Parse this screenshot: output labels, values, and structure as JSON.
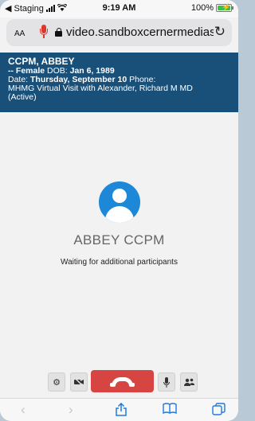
{
  "status_bar": {
    "carrier": "◀ Staging",
    "time": "9:19 AM",
    "battery": "100%",
    "battery_level": 1.0
  },
  "browser": {
    "text_size_label": "AA",
    "url": "video.sandboxcernermedias"
  },
  "patient": {
    "name": "CCPM, ABBEY",
    "line2_prefix": "-- ",
    "sex": "Female",
    "dob_label": " DOB: ",
    "dob": "Jan 6, 1989",
    "date_label": "Date: ",
    "date": "Thursday, September 10",
    "phone_label": " Phone:",
    "visit": "MHMG Virtual Visit with Alexander, Richard M MD",
    "status": "(Active)"
  },
  "call": {
    "participant_name": "ABBEY CCPM",
    "status_text": "Waiting for additional participants"
  },
  "colors": {
    "banner": "#19507a",
    "hangup": "#d64541",
    "avatar": "#1e88d8",
    "ios_blue": "#1c7be0"
  },
  "icons": {
    "settings": "gear-icon",
    "camera": "camera-off-icon",
    "hangup": "phone-hangup-icon",
    "mic": "microphone-icon",
    "participants": "participants-icon"
  }
}
